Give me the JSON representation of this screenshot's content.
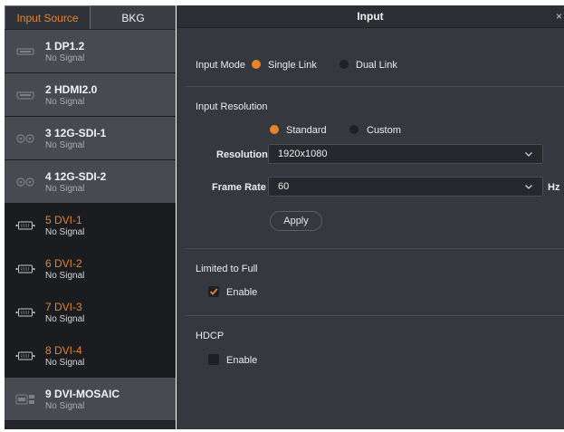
{
  "tabs": {
    "input_source": "Input Source",
    "bkg": "BKG"
  },
  "sources": [
    {
      "name": "1 DP1.2",
      "signal": "No Signal",
      "icon": "dp-port-icon"
    },
    {
      "name": "2 HDMI2.0",
      "signal": "No Signal",
      "icon": "hdmi-port-icon"
    },
    {
      "name": "3 12G-SDI-1",
      "signal": "No Signal",
      "icon": "sdi-port-icon"
    },
    {
      "name": "4 12G-SDI-2",
      "signal": "No Signal",
      "icon": "sdi-port-icon"
    },
    {
      "name": "5 DVI-1",
      "signal": "No Signal",
      "icon": "dvi-port-icon"
    },
    {
      "name": "6 DVI-2",
      "signal": "No Signal",
      "icon": "dvi-port-icon"
    },
    {
      "name": "7 DVI-3",
      "signal": "No Signal",
      "icon": "dvi-port-icon"
    },
    {
      "name": "8 DVI-4",
      "signal": "No Signal",
      "icon": "dvi-port-icon"
    },
    {
      "name": "9 DVI-MOSAIC",
      "signal": "No Signal",
      "icon": "dvi-mosaic-icon"
    }
  ],
  "panel": {
    "title": "Input",
    "close": "×",
    "input_mode": {
      "label": "Input Mode",
      "single": "Single Link",
      "dual": "Dual Link",
      "selected": "single"
    },
    "input_resolution": {
      "heading": "Input Resolution",
      "standard": "Standard",
      "custom": "Custom",
      "selected": "standard",
      "resolution_label": "Resolution",
      "resolution_value": "1920x1080",
      "frame_rate_label": "Frame Rate",
      "frame_rate_value": "60",
      "frame_rate_unit": "Hz",
      "apply": "Apply"
    },
    "limited_to_full": {
      "heading": "Limited to Full",
      "enable": "Enable",
      "checked": true
    },
    "hdcp": {
      "heading": "HDCP",
      "enable": "Enable",
      "checked": false
    }
  },
  "colors": {
    "accent": "#e8832a",
    "panel_bg": "#35383e",
    "list_light": "#474a51",
    "list_dark": "#1b1c1f"
  }
}
